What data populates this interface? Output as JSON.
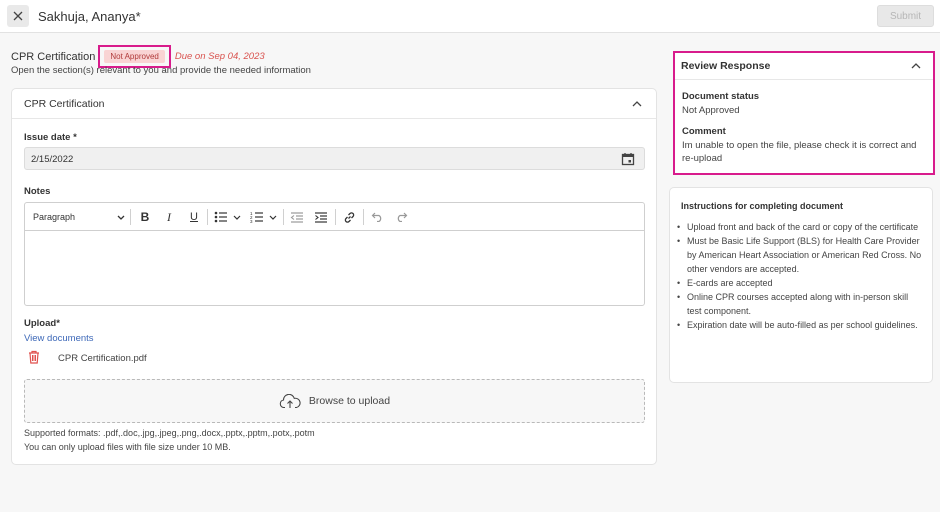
{
  "header": {
    "title": "Sakhuja, Ananya*",
    "submit_label": "Submit"
  },
  "section": {
    "title": "CPR Certification",
    "status": "Not Approved",
    "due": "Due on Sep 04, 2023",
    "subtitle": "Open the section(s) relevant to you and provide the needed information"
  },
  "form": {
    "card_title": "CPR Certification",
    "issue_date_label": "Issue date",
    "issue_date_value": "2/15/2022",
    "notes_label": "Notes",
    "editor": {
      "block_style": "Paragraph"
    },
    "upload_label": "Upload",
    "view_documents": "View documents",
    "file_name": "CPR Certification.pdf",
    "browse_label": "Browse to upload",
    "formats_text": "Supported formats: .pdf,.doc,.jpg,.jpeg,.png,.docx,.pptx,.pptm,.potx,.potm",
    "size_text": "You can only upload files with file size under 10 MB."
  },
  "review": {
    "title": "Review Response",
    "doc_status_label": "Document status",
    "doc_status_value": "Not Approved",
    "comment_label": "Comment",
    "comment_value": "Im unable to open the file, please check it is correct and re-upload"
  },
  "instructions": {
    "title": "Instructions for completing document",
    "items": [
      "Upload front and back of the card or copy of the certificate",
      "Must be Basic Life Support (BLS) for Health Care Provider by American Heart Association or American Red Cross. No other vendors are accepted.",
      "E-cards are accepted",
      "Online CPR courses accepted along with in-person skill test component.",
      "Expiration date will be auto-filled as per school guidelines."
    ]
  },
  "colors": {
    "highlight": "#d81b8c",
    "link": "#3d68b8",
    "due": "#d9534f",
    "trash": "#e0524e"
  }
}
